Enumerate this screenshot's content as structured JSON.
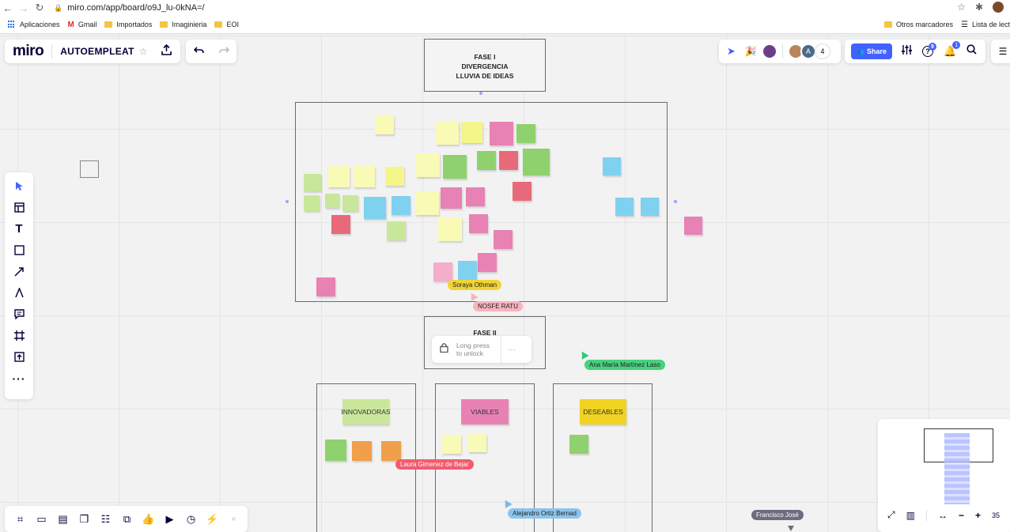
{
  "browser": {
    "url": "miro.com/app/board/o9J_lu-0kNA=/",
    "bookmarks": [
      "Aplicaciones",
      "Gmail",
      "Importados",
      "Imaginieria",
      "EOI"
    ],
    "bookmarks_right": [
      "Otros marcadores",
      "Lista de lect"
    ]
  },
  "header": {
    "logo": "miro",
    "board_name": "AUTOEMPLEAT",
    "share_label": "Share",
    "collaborator_count": "4",
    "avatar_letter": "A",
    "help_badge": "9",
    "notif_badge": "1"
  },
  "frames": {
    "fase1": [
      "FASE I",
      "DIVERGENCIA",
      "LLUVIA DE IDEAS"
    ],
    "fase2": "FASE II",
    "lock_label_1": "Long press",
    "lock_label_2": "to unlock"
  },
  "categories": {
    "innovadoras": "INNOVADORAS",
    "viables": "VIABLES",
    "deseables": "DESEABLES"
  },
  "cursors": {
    "soraya": "Soraya Othman",
    "nosfe": "NOSFE RATU",
    "ana": "Ana María Martínez Laso",
    "laura": "Laura Gimenez de Bejar",
    "alejandro": "Alejandro Ortiz Bernad",
    "francisco": "Francisco José"
  },
  "zoom": "35"
}
